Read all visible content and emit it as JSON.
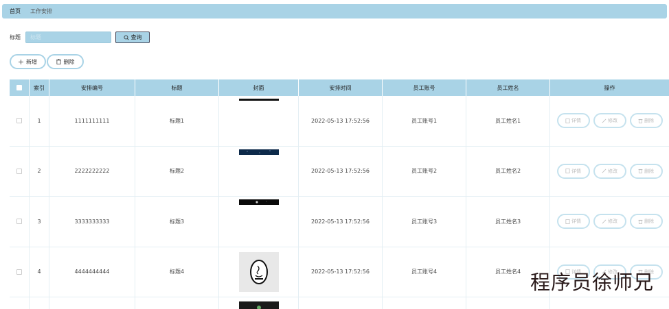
{
  "breadcrumb": {
    "home": "首页",
    "current": "工作安排"
  },
  "search": {
    "label": "标题",
    "placeholder": "标题",
    "query_label": "查询"
  },
  "actions": {
    "add_label": "新增",
    "delete_label": "删除"
  },
  "table": {
    "headers": {
      "index": "索引",
      "code": "安排编号",
      "title": "标题",
      "cover": "封面",
      "time": "安排时间",
      "account": "员工账号",
      "name": "员工姓名",
      "ops": "操作"
    },
    "op_labels": {
      "detail": "详情",
      "edit": "修改",
      "delete": "删除"
    },
    "rows": [
      {
        "index": "1",
        "code": "1111111111",
        "title": "标题1",
        "time": "2022-05-13 17:52:56",
        "account": "员工账号1",
        "name": "员工姓名1"
      },
      {
        "index": "2",
        "code": "2222222222",
        "title": "标题2",
        "time": "2022-05-13 17:52:56",
        "account": "员工账号2",
        "name": "员工姓名2"
      },
      {
        "index": "3",
        "code": "3333333333",
        "title": "标题3",
        "time": "2022-05-13 17:52:56",
        "account": "员工账号3",
        "name": "员工姓名3"
      },
      {
        "index": "4",
        "code": "4444444444",
        "title": "标题4",
        "time": "2022-05-13 17:52:56",
        "account": "员工账号4",
        "name": "员工姓名4"
      }
    ]
  },
  "watermark": "程序员徐师兄",
  "colors": {
    "accent": "#a9d3e6",
    "border": "#e3eef3"
  }
}
